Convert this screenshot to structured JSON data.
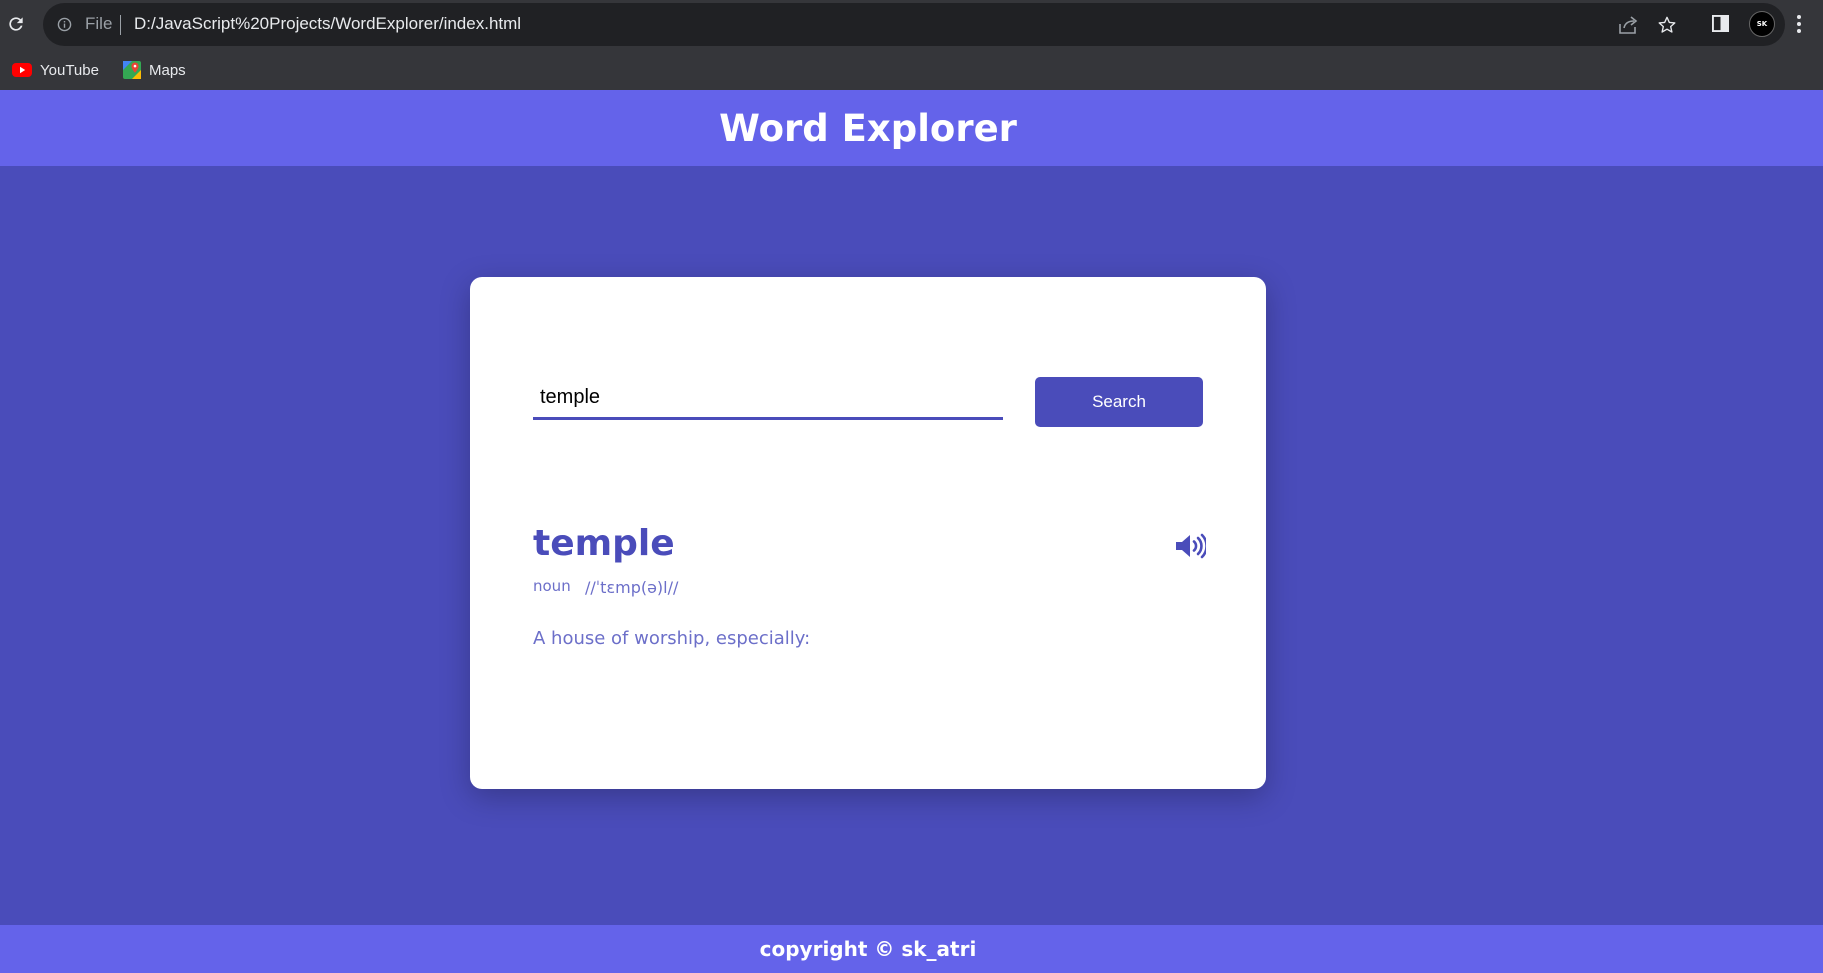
{
  "browser": {
    "file_label": "File",
    "url": "D:/JavaScript%20Projects/WordExplorer/index.html",
    "avatar_text": "SK",
    "bookmarks": [
      {
        "label": "YouTube",
        "icon": "youtube-icon"
      },
      {
        "label": "Maps",
        "icon": "maps-icon"
      }
    ]
  },
  "header": {
    "title": "Word Explorer"
  },
  "search": {
    "value": "temple",
    "button_label": "Search"
  },
  "result": {
    "word": "temple",
    "part_of_speech": "noun",
    "phonetic": "//ˈtɛmp(ə)l//",
    "definition": "A house of worship, especially:",
    "sound_icon": "speaker-icon"
  },
  "footer": {
    "text": "copyright © sk_atri"
  },
  "colors": {
    "page_bg": "#4a4cba",
    "header_bg": "#6463ea",
    "accent": "#4a4cba",
    "muted_text": "#6c6fc9"
  }
}
